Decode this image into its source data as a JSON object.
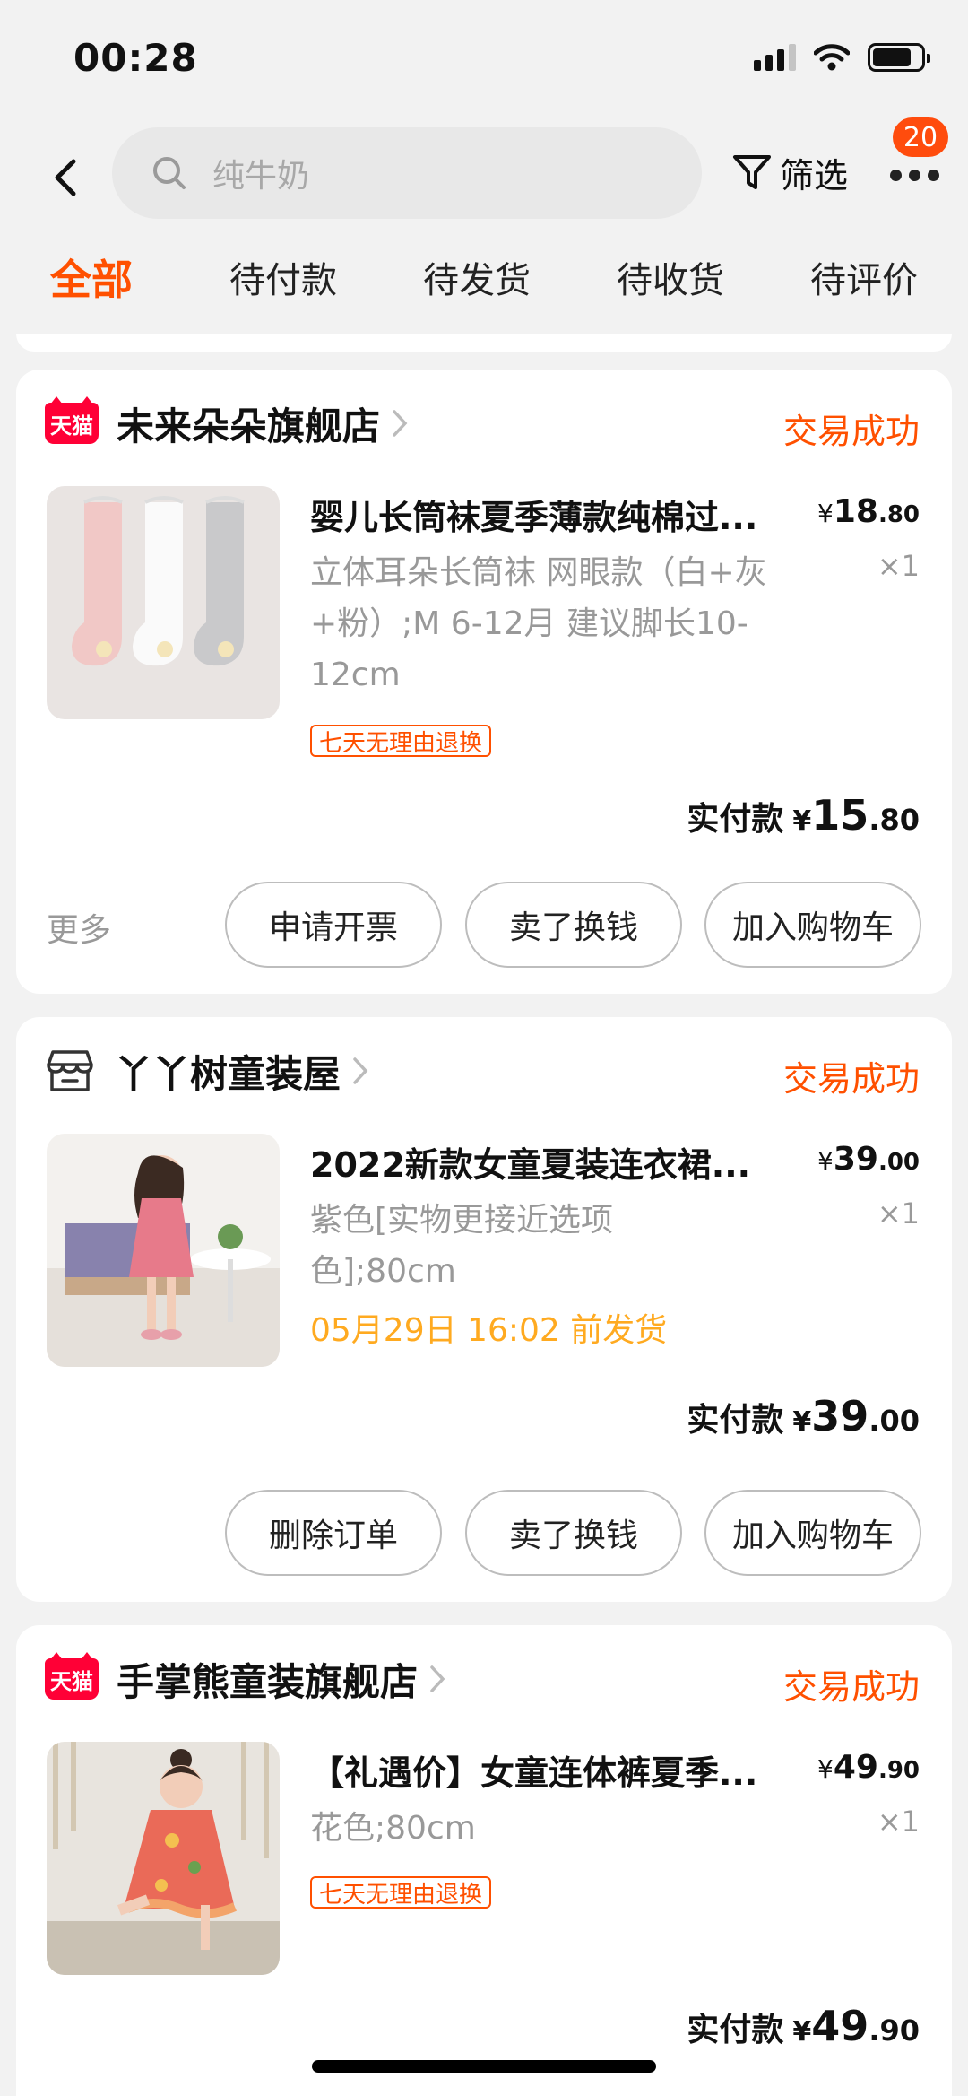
{
  "status_bar": {
    "time": "00:28"
  },
  "header": {
    "search_placeholder": "纯牛奶",
    "filter_label": "筛选",
    "notification_count": "20"
  },
  "tabs": [
    "全部",
    "待付款",
    "待发货",
    "待收货",
    "待评价"
  ],
  "active_tab": "全部",
  "colors": {
    "accent": "#ff5000",
    "ship_note": "#ffaa20",
    "tmall_red": "#ff0036",
    "badge": "#ff4c0d"
  },
  "orders": [
    {
      "shop_badge": "天猫",
      "shop_name": "未来朵朵旗舰店",
      "status": "交易成功",
      "item": {
        "title": "婴儿长筒袜夏季薄款纯棉过...",
        "price_currency": "¥",
        "price_int": "18",
        "price_dec": ".80",
        "quantity": "×1",
        "spec": "立体耳朵长筒袜 网眼款（白+灰+粉）;M 6-12月 建议脚长10-12cm",
        "tag": "七天无理由退换"
      },
      "paid_label": "实付款",
      "paid_currency": "¥",
      "paid_int": "15",
      "paid_dec": ".80",
      "more_label": "更多",
      "actions": [
        "申请开票",
        "卖了换钱",
        "加入购物车"
      ]
    },
    {
      "shop_icon": "store-icon",
      "shop_name": "丫丫树童装屋",
      "status": "交易成功",
      "item": {
        "title": "2022新款女童夏装连衣裙...",
        "price_currency": "¥",
        "price_int": "39",
        "price_dec": ".00",
        "quantity": "×1",
        "spec": "紫色[实物更接近选项色];80cm",
        "ship_note": "05月29日 16:02 前发货"
      },
      "paid_label": "实付款",
      "paid_currency": "¥",
      "paid_int": "39",
      "paid_dec": ".00",
      "actions": [
        "删除订单",
        "卖了换钱",
        "加入购物车"
      ]
    },
    {
      "shop_badge": "天猫",
      "shop_name": "手掌熊童装旗舰店",
      "status": "交易成功",
      "item": {
        "title": "【礼遇价】女童连体裤夏季...",
        "price_currency": "¥",
        "price_int": "49",
        "price_dec": ".90",
        "quantity": "×1",
        "spec": "花色;80cm",
        "tag": "七天无理由退换"
      },
      "paid_label": "实付款",
      "paid_currency": "¥",
      "paid_int": "49",
      "paid_dec": ".90"
    }
  ]
}
